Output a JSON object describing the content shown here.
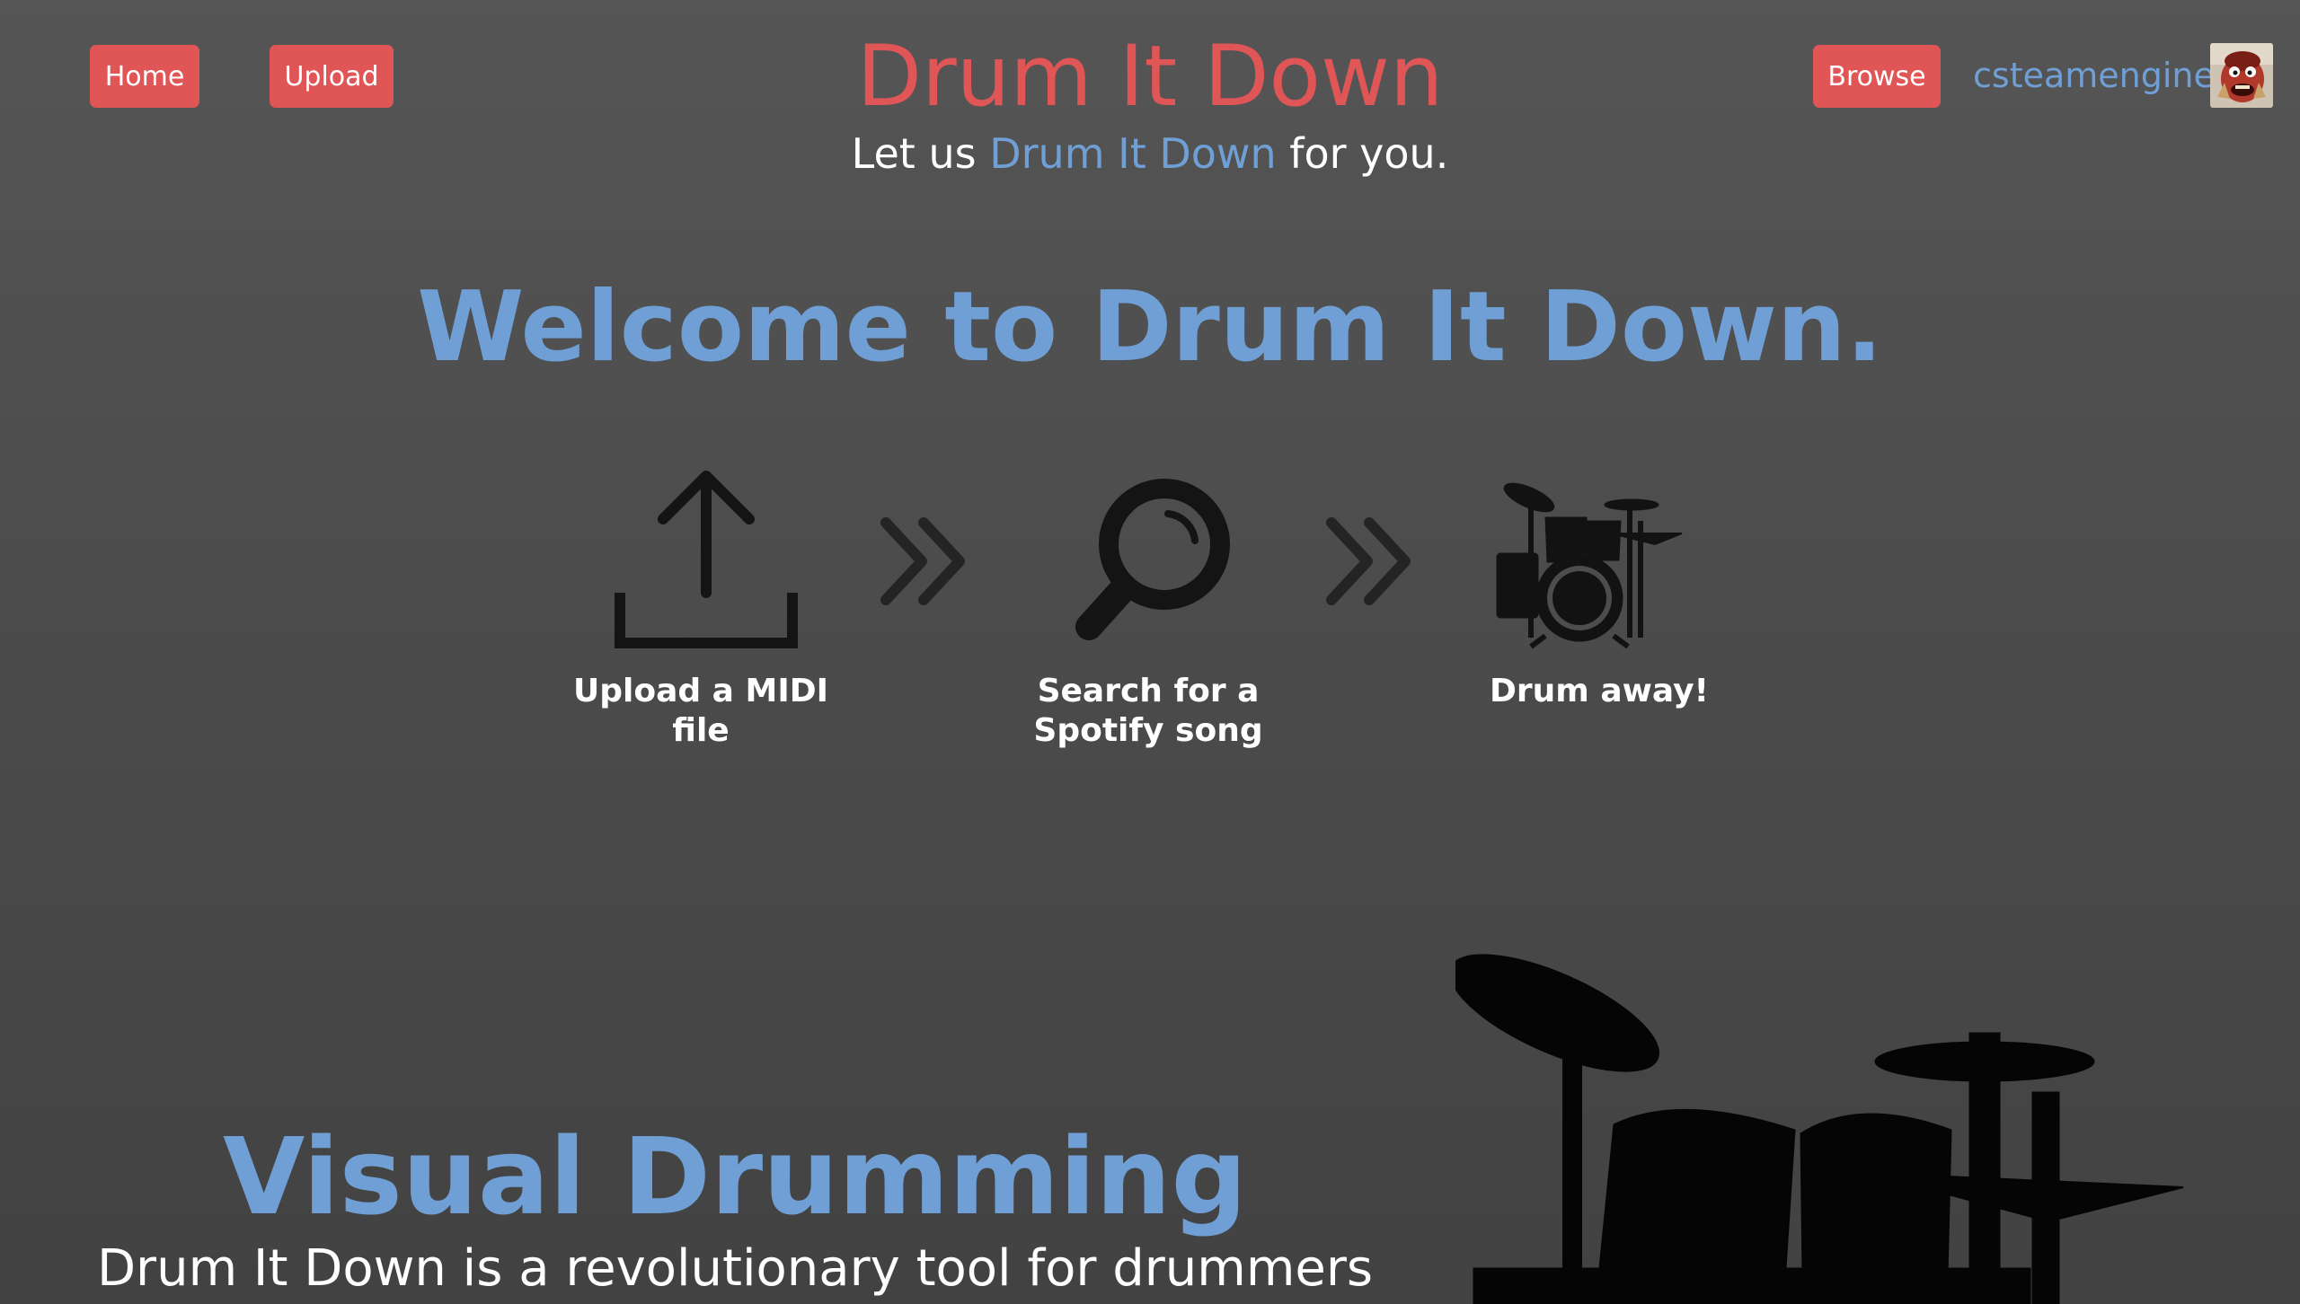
{
  "header": {
    "nav": {
      "home_label": "Home",
      "upload_label": "Upload",
      "browse_label": "Browse"
    },
    "title": "Drum It Down",
    "tagline": {
      "prefix": "Let us ",
      "accent": "Drum It Down",
      "suffix": " for you."
    },
    "user": {
      "username": "csteamengine"
    }
  },
  "welcome": {
    "heading": "Welcome to Drum It Down."
  },
  "steps": [
    {
      "label": "Upload a MIDI file",
      "icon": "upload-icon"
    },
    {
      "label": "Search for a Spotify song",
      "icon": "search-icon"
    },
    {
      "label": "Drum away!",
      "icon": "drum-kit-icon"
    }
  ],
  "visual_drumming": {
    "heading": "Visual Drumming",
    "description": "Drum It Down is a revolutionary tool for drummers"
  },
  "colors": {
    "brand_red": "#e05555",
    "accent_blue": "#6f9fd4",
    "background": "#4b4b4b",
    "icon_dark": "#111111"
  }
}
